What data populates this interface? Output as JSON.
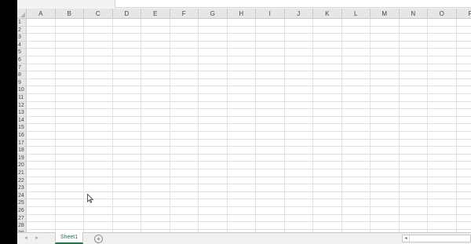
{
  "spreadsheet": {
    "columns": [
      "A",
      "B",
      "C",
      "D",
      "E",
      "F",
      "G",
      "H",
      "I",
      "J",
      "K",
      "L",
      "M",
      "N",
      "O",
      "P"
    ],
    "rows": [
      "1",
      "2",
      "3",
      "4",
      "5",
      "6",
      "7",
      "8",
      "9",
      "10",
      "11",
      "12",
      "13",
      "14",
      "15",
      "16",
      "17",
      "18",
      "19",
      "20",
      "21",
      "22",
      "23",
      "24",
      "25",
      "26",
      "27",
      "28",
      "29"
    ]
  },
  "sheet_tabs": {
    "active_label": "Sheet1",
    "add_symbol": "+",
    "prev_symbol": "◂",
    "next_symbol": "▸",
    "scroll_left_symbol": "◂"
  },
  "icons": {
    "add_sheet": "plus-circle-icon",
    "cursor": "mouse-pointer-icon",
    "scroll_left": "chevron-left-icon"
  },
  "colors": {
    "header_bg": "#e6e6e6",
    "grid_line": "#e1e1e1",
    "active_tab_accent": "#217346"
  }
}
